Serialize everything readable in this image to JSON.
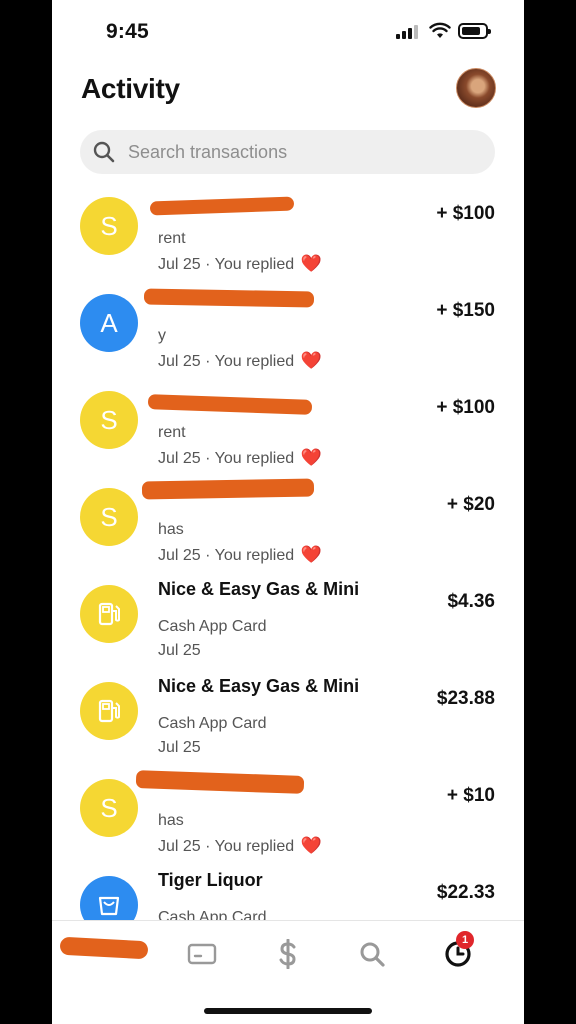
{
  "status_bar": {
    "time": "9:45"
  },
  "header": {
    "title": "Activity"
  },
  "search": {
    "placeholder": "Search transactions"
  },
  "transactions": [
    {
      "initial": "S",
      "icon_color": "#f5d733",
      "note": "rent",
      "date": "Jul 25",
      "status": "You replied",
      "amount": "+ $100"
    },
    {
      "initial": "A",
      "icon_color": "#2d8cf0",
      "note": "y",
      "date": "Jul 25",
      "status": "You replied",
      "amount": "+ $150"
    },
    {
      "initial": "S",
      "icon_color": "#f5d733",
      "note": "rent",
      "date": "Jul 25",
      "status": "You replied",
      "amount": "+ $100"
    },
    {
      "initial": "S",
      "icon_color": "#f5d733",
      "note": "has",
      "date": "Jul 25",
      "status": "You replied",
      "amount": "+ $20"
    },
    {
      "icon": "gas-station-icon",
      "icon_color": "#f5d733",
      "name": "Nice & Easy Gas & Mini",
      "note": "Cash App Card",
      "date": "Jul 25",
      "amount": "$4.36"
    },
    {
      "icon": "gas-station-icon",
      "icon_color": "#f5d733",
      "name": "Nice & Easy Gas & Mini",
      "note": "Cash App Card",
      "date": "Jul 25",
      "amount": "$23.88"
    },
    {
      "initial": "S",
      "icon_color": "#f5d733",
      "note": "has",
      "date": "Jul 25",
      "status": "You replied",
      "amount": "+ $10"
    },
    {
      "icon": "shopping-bag-icon",
      "icon_color": "#2d8cf0",
      "name": "Tiger Liquor",
      "note": "Cash App Card",
      "amount": "$22.33"
    }
  ],
  "tab_bar": {
    "items": [
      "money-tab-icon",
      "card-icon",
      "dollar-icon",
      "search-icon",
      "activity-clock-icon"
    ],
    "activity_badge": "1"
  },
  "colors": {
    "accent_yellow": "#f5d733",
    "accent_blue": "#2d8cf0",
    "redaction": "#e2621c",
    "heart": "#e0262b"
  }
}
